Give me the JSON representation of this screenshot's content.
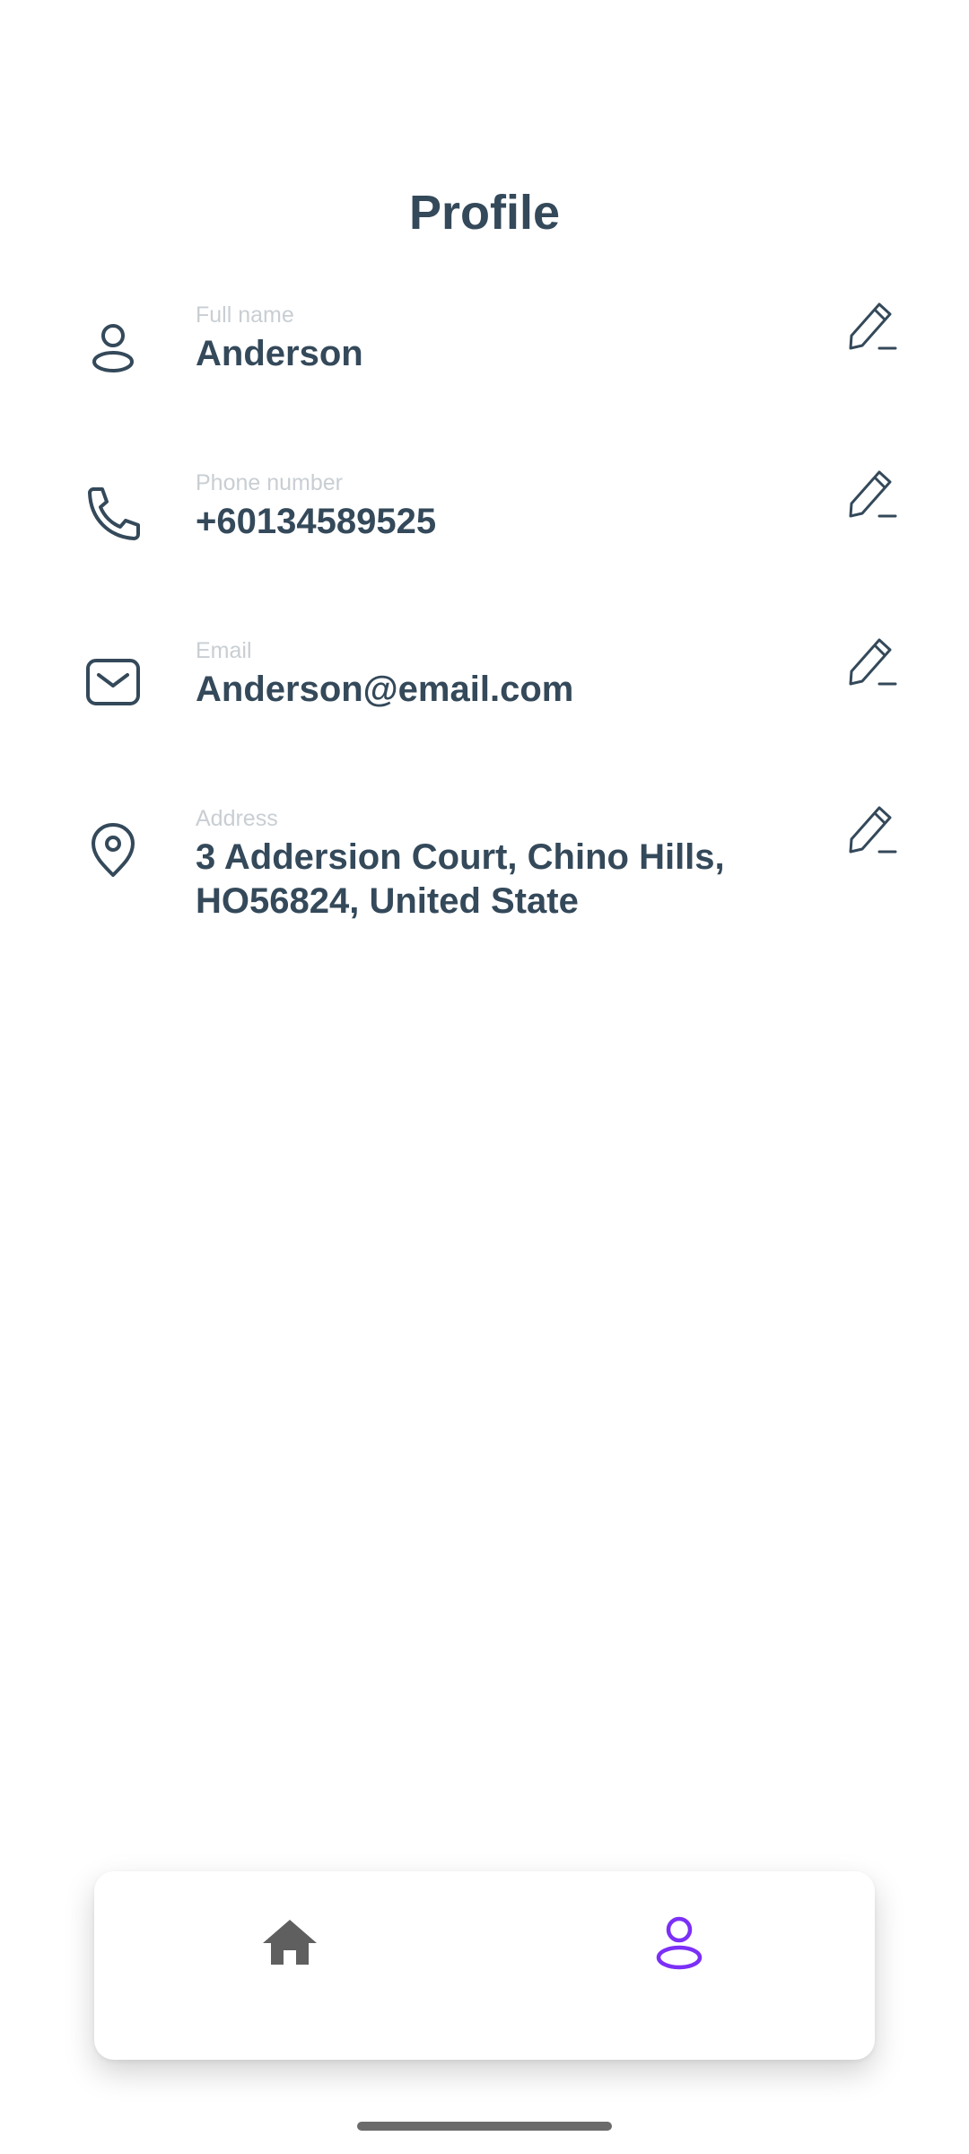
{
  "header": {
    "title": "Profile"
  },
  "profile": {
    "fields": [
      {
        "label": "Full name",
        "value": "Anderson",
        "icon": "person-icon"
      },
      {
        "label": "Phone number",
        "value": "+60134589525",
        "icon": "phone-icon"
      },
      {
        "label": "Email",
        "value": "Anderson@email.com",
        "icon": "mail-icon"
      },
      {
        "label": "Address",
        "value": "3 Addersion Court, Chino Hills, HO56824, United State",
        "icon": "location-pin-icon"
      }
    ],
    "edit_icon": "pencil-icon"
  },
  "bottom_nav": {
    "items": [
      {
        "name": "home",
        "icon": "home-icon",
        "active": false
      },
      {
        "name": "profile",
        "icon": "person-icon",
        "active": true
      }
    ],
    "active_color": "#7b2ff7",
    "inactive_color": "#5f5f5f"
  },
  "colors": {
    "text_primary": "#34495a",
    "label_muted": "#c9ced3"
  }
}
